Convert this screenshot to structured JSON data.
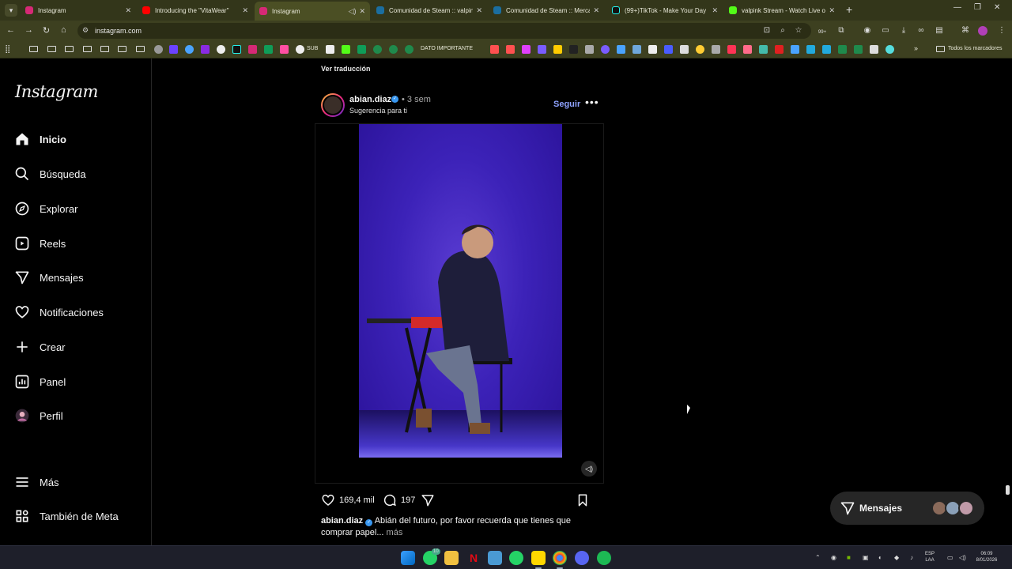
{
  "browser": {
    "tabs": [
      {
        "title": "Instagram",
        "favicon_color": "#d62976",
        "active": false
      },
      {
        "title": "Introducing the \"VitaWear\"",
        "favicon_color": "#ff0000",
        "active": false
      },
      {
        "title": "Instagram",
        "favicon_color": "#d62976",
        "active": true
      },
      {
        "title": "Comunidad de Steam :: valpink",
        "favicon_color": "#1b2838",
        "active": false
      },
      {
        "title": "Comunidad de Steam :: Mercado",
        "favicon_color": "#1b2838",
        "active": false
      },
      {
        "title": "(99+)TikTok - Make Your Day",
        "favicon_color": "#111111",
        "active": false
      },
      {
        "title": "valpink Stream - Watch Live on",
        "favicon_color": "#53fc18",
        "active": false
      }
    ],
    "url": "instagram.com",
    "bookmarks": {
      "sub_label": "SUB",
      "dato_label": "DATO IMPORTANTE",
      "all_label": "Todos los marcadores"
    },
    "ext_badge": "99+"
  },
  "sidebar": {
    "logo": "Instagram",
    "items": [
      {
        "label": "Inicio",
        "icon": "home-icon"
      },
      {
        "label": "Búsqueda",
        "icon": "search-icon"
      },
      {
        "label": "Explorar",
        "icon": "compass-icon"
      },
      {
        "label": "Reels",
        "icon": "reels-icon"
      },
      {
        "label": "Mensajes",
        "icon": "messages-icon"
      },
      {
        "label": "Notificaciones",
        "icon": "heart-icon"
      },
      {
        "label": "Crear",
        "icon": "plus-icon"
      },
      {
        "label": "Panel",
        "icon": "dashboard-icon"
      },
      {
        "label": "Perfil",
        "icon": "avatar"
      }
    ],
    "more_label": "Más",
    "meta_label": "También de Meta"
  },
  "post": {
    "ver_traduccion": "Ver traducción",
    "username": "abian.diaz",
    "time": "• 3 sem",
    "subtitle": "Sugerencia para ti",
    "follow_label": "Seguir",
    "likes": "169,4 mil",
    "comments": "197",
    "caption_user": "abian.diaz",
    "caption_text": "Abián del futuro, por favor recuerda que tienes que comprar papel...",
    "caption_more": "más"
  },
  "messages_pill": {
    "label": "Mensajes"
  },
  "taskbar": {
    "lang_line1": "ESP",
    "lang_line2": "LAA",
    "time": "06:09",
    "date": "8/01/2026",
    "whatsapp_badge": "10"
  }
}
